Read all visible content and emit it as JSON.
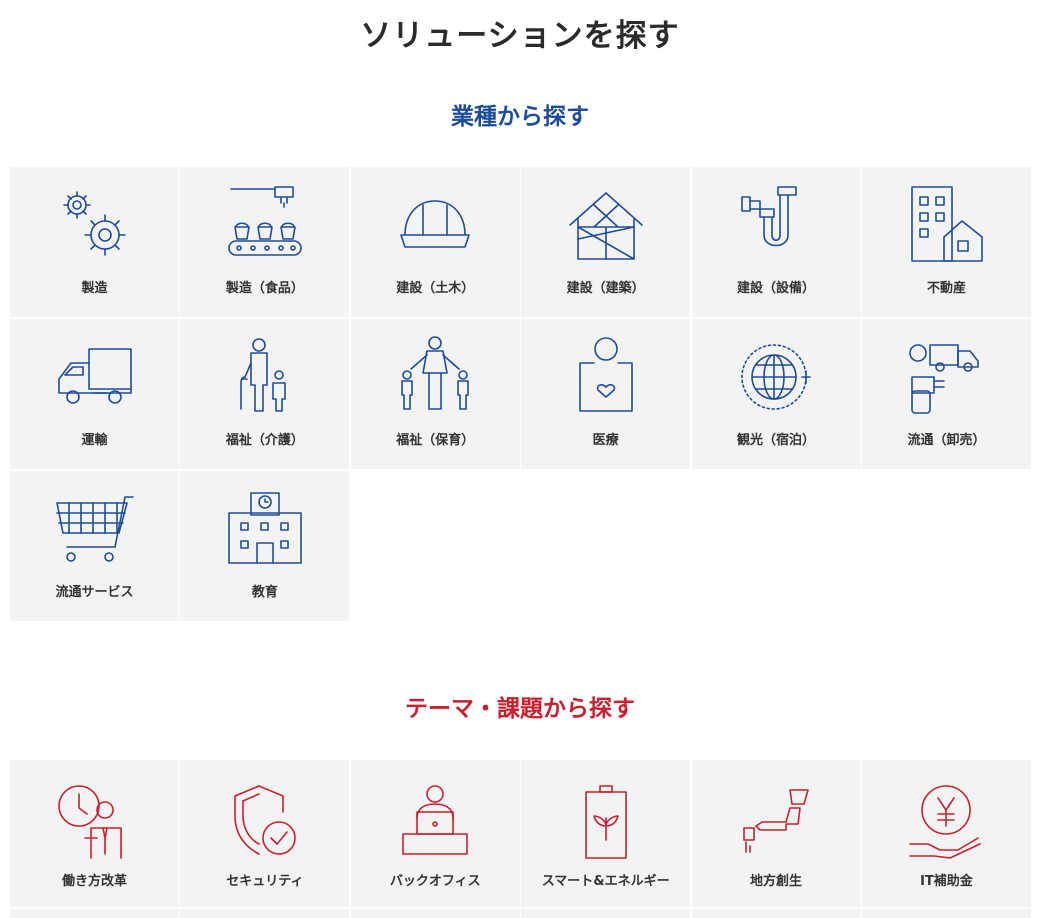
{
  "page": {
    "title": "ソリューションを探す"
  },
  "industry": {
    "title": "業種から探す",
    "items": [
      {
        "label": "製造",
        "icon": "gears-icon"
      },
      {
        "label": "製造（食品）",
        "icon": "food-conveyor-icon"
      },
      {
        "label": "建設（土木）",
        "icon": "hard-hat-icon"
      },
      {
        "label": "建設（建築）",
        "icon": "building-frame-icon"
      },
      {
        "label": "建設（設備）",
        "icon": "pipe-icon"
      },
      {
        "label": "不動産",
        "icon": "real-estate-icon"
      },
      {
        "label": "運輸",
        "icon": "truck-icon"
      },
      {
        "label": "福祉（介護）",
        "icon": "elderly-care-icon"
      },
      {
        "label": "福祉（保育）",
        "icon": "childcare-icon"
      },
      {
        "label": "医療",
        "icon": "medical-icon"
      },
      {
        "label": "観光（宿泊）",
        "icon": "globe-travel-icon"
      },
      {
        "label": "流通（卸売）",
        "icon": "wholesale-icon"
      },
      {
        "label": "流通サービス",
        "icon": "shopping-cart-icon"
      },
      {
        "label": "教育",
        "icon": "school-icon"
      }
    ]
  },
  "theme": {
    "title": "テーマ・課題から探す",
    "items": [
      {
        "label": "働き方改革",
        "icon": "work-style-icon"
      },
      {
        "label": "セキュリティ",
        "icon": "security-shield-icon"
      },
      {
        "label": "バックオフィス",
        "icon": "back-office-icon"
      },
      {
        "label": "スマート&エネルギー",
        "icon": "battery-energy-icon"
      },
      {
        "label": "地方創生",
        "icon": "regional-map-icon"
      },
      {
        "label": "IT補助金",
        "icon": "subsidy-coin-icon"
      }
    ]
  },
  "colors": {
    "industry_accent": "#1e4c9a",
    "theme_accent": "#c8202f",
    "tile_bg": "#f3f3f3"
  }
}
